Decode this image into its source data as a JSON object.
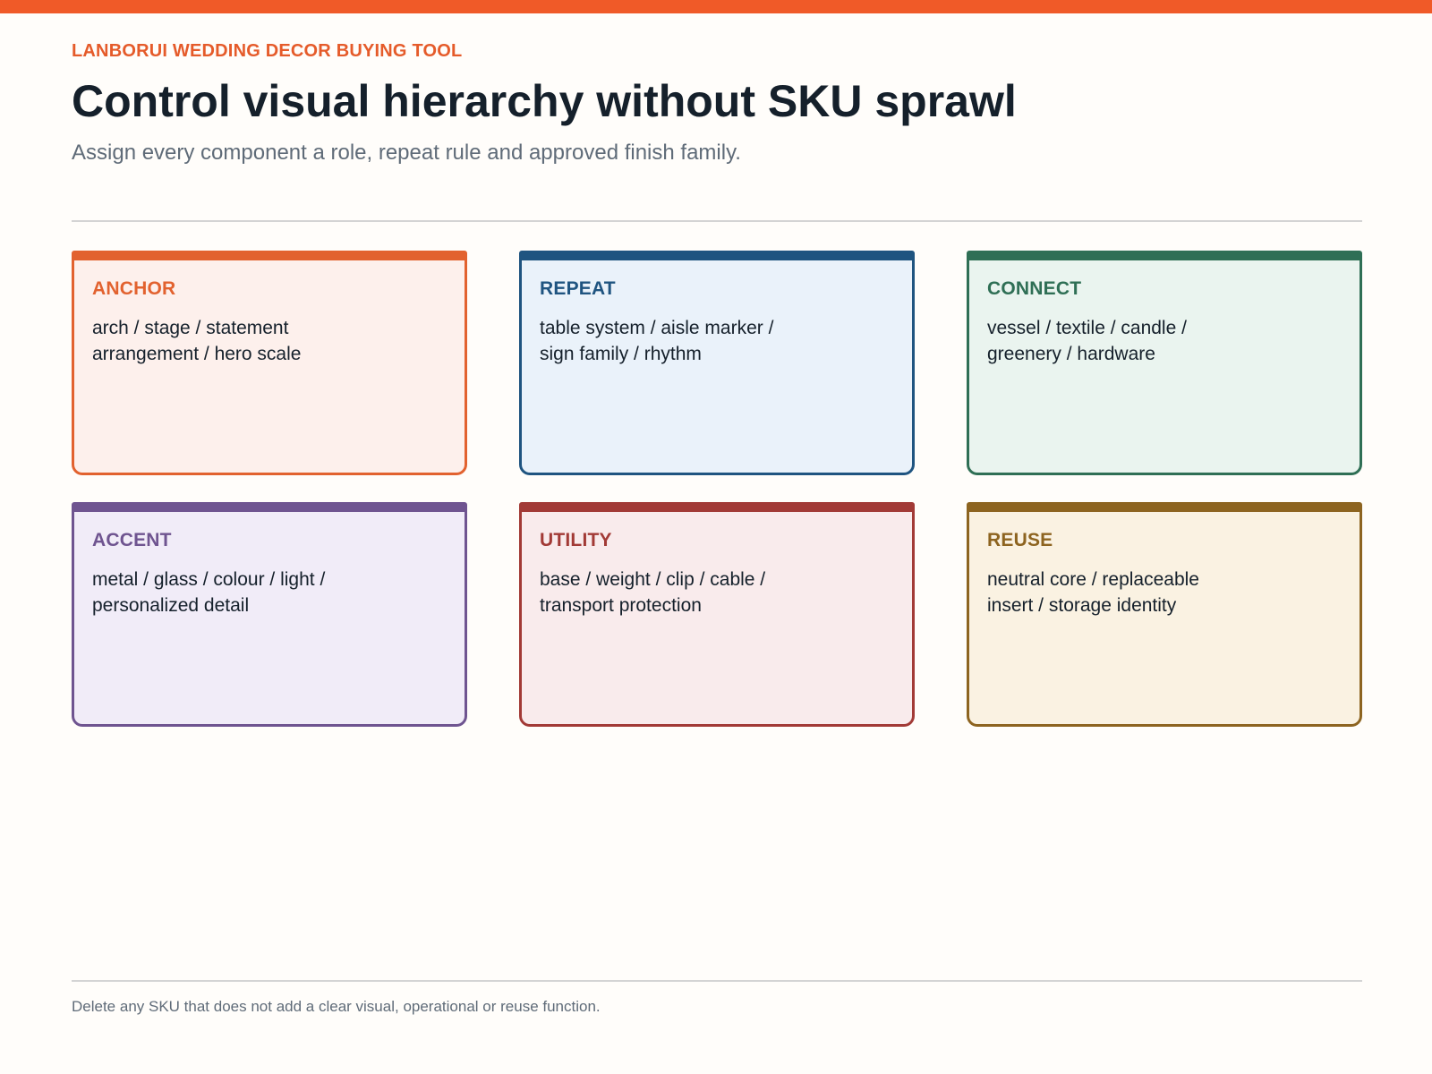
{
  "header": {
    "eyebrow": "LANBORUI WEDDING DECOR BUYING TOOL",
    "title": "Control visual hierarchy without SKU sprawl",
    "subtitle": "Assign every component a role, repeat rule and approved finish family."
  },
  "colors": {
    "accent": "#f05a28",
    "anchor": "#e2622f",
    "repeat": "#1f5480",
    "connect": "#2f6f55",
    "accent_role": "#6f5490",
    "utility": "#a23a36",
    "reuse": "#8d6420"
  },
  "cards": [
    {
      "label": "ANCHOR",
      "text": "arch / stage / statement arrangement / hero scale",
      "color": "#e2622f",
      "bg": "#fdf0ec"
    },
    {
      "label": "REPEAT",
      "text": "table system / aisle marker / sign family / rhythm",
      "color": "#1f5480",
      "bg": "#eaf2fa"
    },
    {
      "label": "CONNECT",
      "text": "vessel / textile / candle / greenery / hardware",
      "color": "#2f6f55",
      "bg": "#eaf4ef"
    },
    {
      "label": "ACCENT",
      "text": "metal / glass / colour / light / personalized detail",
      "color": "#6f5490",
      "bg": "#f1ecf8"
    },
    {
      "label": "UTILITY",
      "text": "base / weight / clip / cable / transport protection",
      "color": "#a23a36",
      "bg": "#f9ebec"
    },
    {
      "label": "REUSE",
      "text": "neutral core / replaceable insert / storage identity",
      "color": "#8d6420",
      "bg": "#faf2e2"
    }
  ],
  "footer": {
    "note": "Delete any SKU that does not add a clear visual, operational or reuse function."
  }
}
